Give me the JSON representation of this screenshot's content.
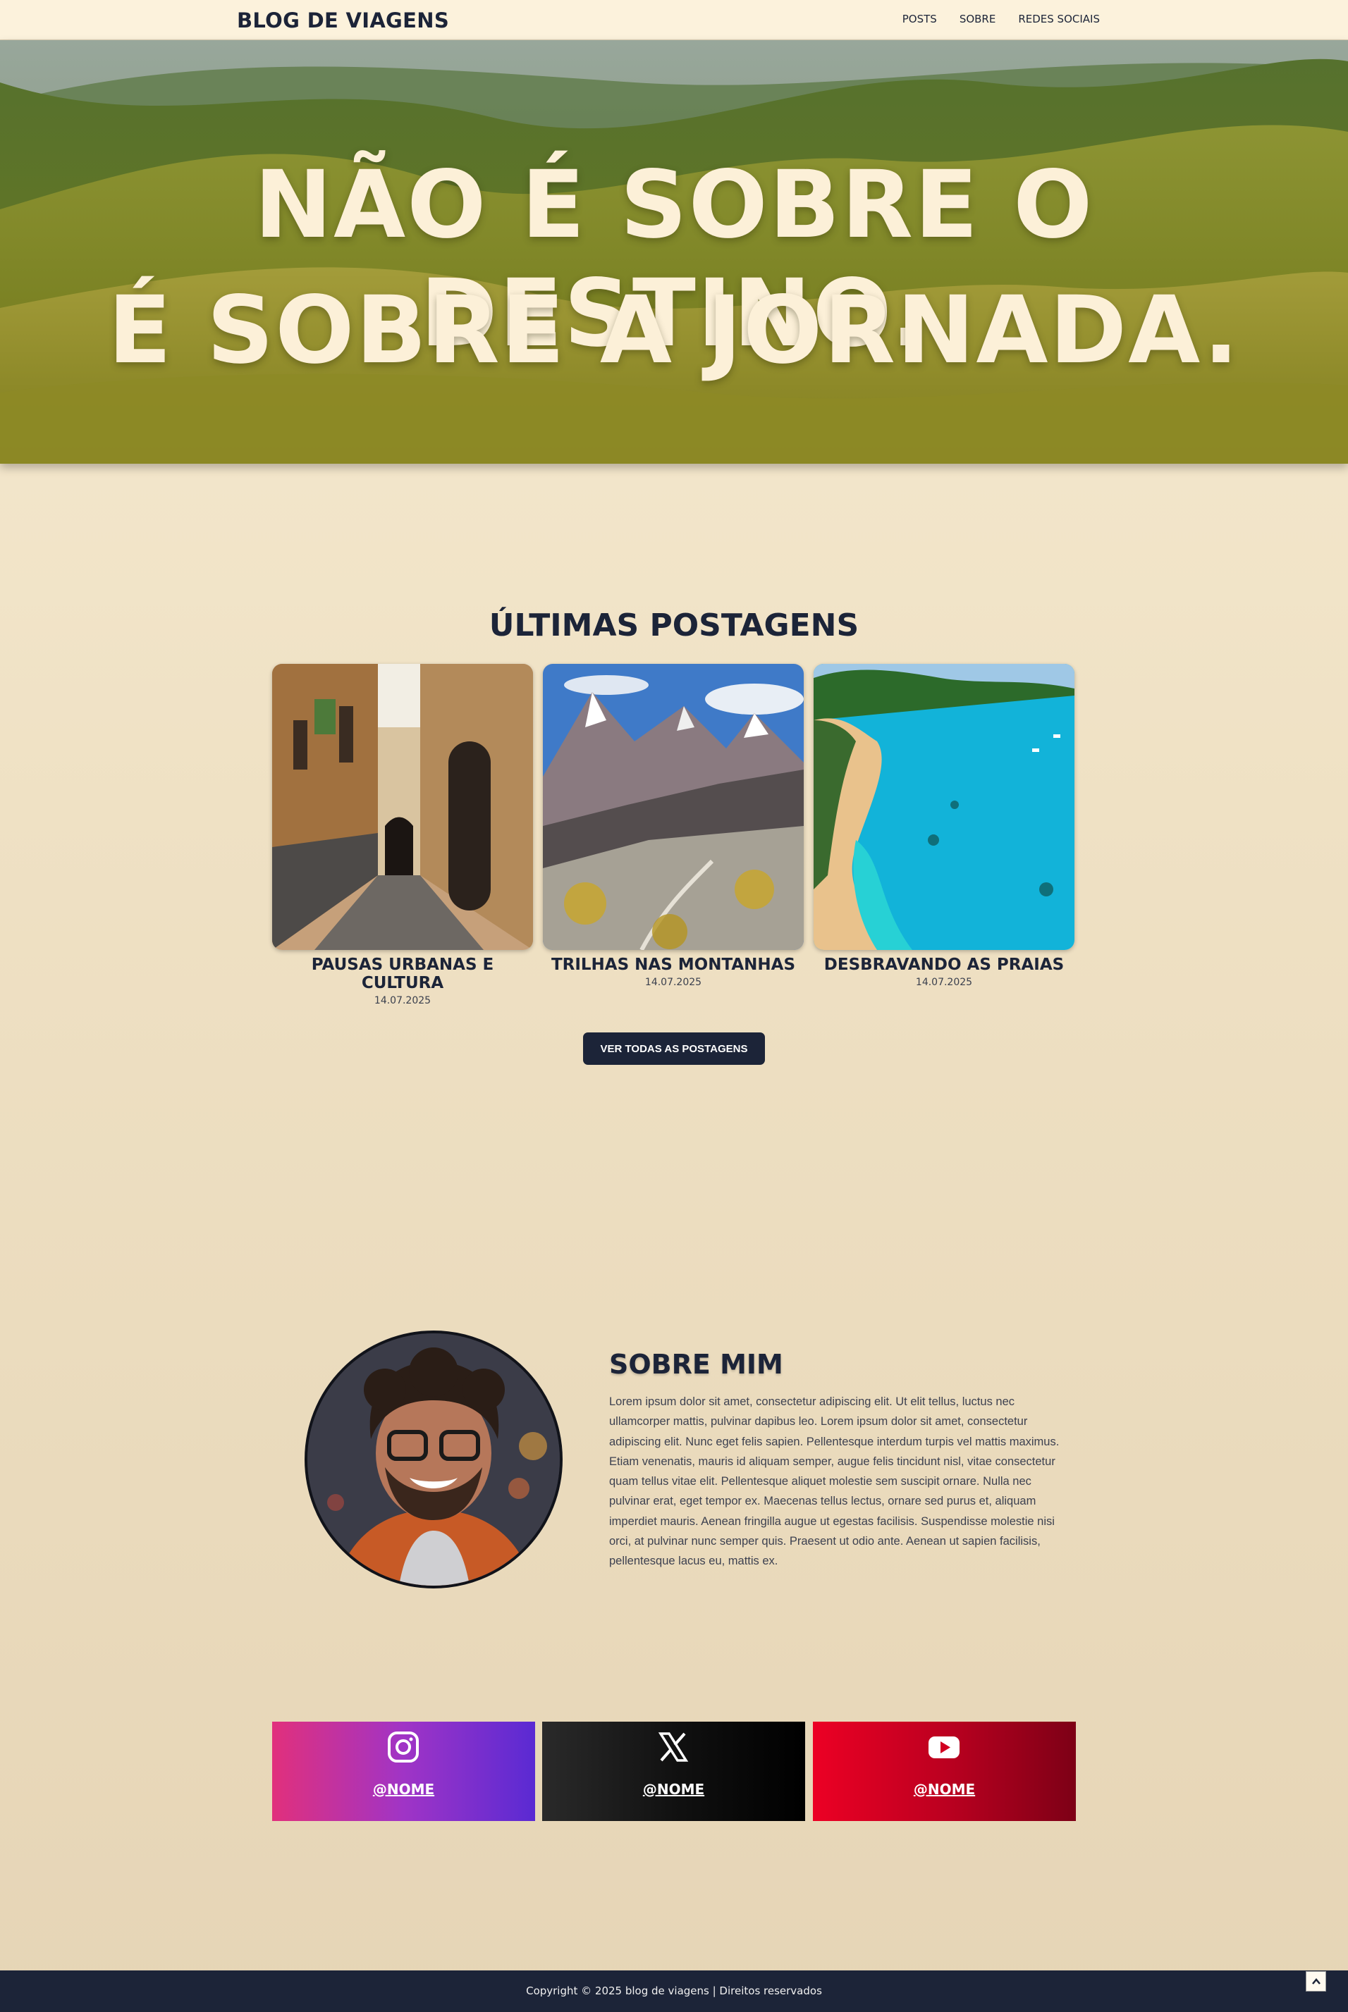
{
  "nav": {
    "brand": "BLOG DE VIAGENS",
    "links": [
      "POSTS",
      "SOBRE",
      "REDES SOCIAIS"
    ]
  },
  "hero": {
    "line1": "NÃO É SOBRE O DESTINO.",
    "line2": "É SOBRE A JORNADA."
  },
  "posts": {
    "title": "ÚLTIMAS POSTAGENS",
    "items": [
      {
        "title": "PAUSAS URBANAS E CULTURA",
        "date": "14.07.2025"
      },
      {
        "title": "TRILHAS NAS MONTANHAS",
        "date": "14.07.2025"
      },
      {
        "title": "DESBRAVANDO AS PRAIAS",
        "date": "14.07.2025"
      }
    ],
    "button": "VER TODAS AS POSTAGENS"
  },
  "about": {
    "title": "SOBRE MIM",
    "text": "Lorem ipsum dolor sit amet, consectetur adipiscing elit. Ut elit tellus, luctus nec ullamcorper mattis, pulvinar dapibus leo. Lorem ipsum dolor sit amet, consectetur adipiscing elit. Nunc eget felis sapien. Pellentesque interdum turpis vel mattis maximus. Etiam venenatis, mauris id aliquam semper, augue felis tincidunt nisl, vitae consectetur quam tellus vitae elit. Pellentesque aliquet molestie sem suscipit ornare. Nulla nec pulvinar erat, eget tempor ex. Maecenas tellus lectus, ornare sed purus et, aliquam imperdiet mauris. Aenean fringilla augue ut egestas facilisis. Suspendisse molestie nisi orci, at pulvinar nunc semper quis. Praesent ut odio ante. Aenean ut sapien facilisis, pellentesque lacus eu, mattis ex."
  },
  "social": [
    {
      "network": "instagram",
      "icon": "instagram-icon",
      "handle": "@NOME"
    },
    {
      "network": "x",
      "icon": "x-icon",
      "handle": "@NOME"
    },
    {
      "network": "youtube",
      "icon": "youtube-icon",
      "handle": "@NOME"
    }
  ],
  "footer": {
    "text": "Copyright © 2025 blog de viagens | Direitos reservados"
  },
  "colors": {
    "primary": "#1c2438",
    "background": "#f3e6cb",
    "hero_text": "#fcf0d8"
  }
}
